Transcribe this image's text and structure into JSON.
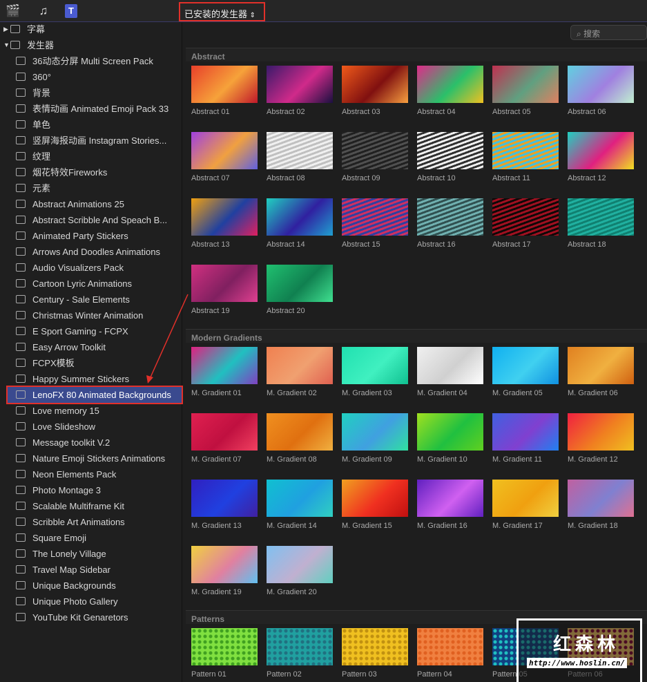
{
  "toolbar": {
    "picker_label": "已安装的发生器",
    "picker_chevron": "⌃⌄",
    "icons": [
      "clapper-icon",
      "music-icon",
      "titles-generators-icon"
    ]
  },
  "sidebar": {
    "titles": "字幕",
    "generators": "发生器",
    "items": [
      "36动态分屏 Multi Screen Pack",
      "360°",
      "背景",
      "表情动画 Animated Emoji Pack 33",
      "单色",
      "竖屏海报动画 Instagram Stories...",
      "纹理",
      "烟花特效Fireworks",
      "元素",
      "Abstract Animations 25",
      "Abstract Scribble And Speach B...",
      "Animated Party Stickers",
      "Arrows And Doodles Animations",
      "Audio Visualizers Pack",
      "Cartoon Lyric Animations",
      "Century - Sale Elements",
      "Christmas Winter Animation",
      "E Sport Gaming - FCPX",
      "Easy Arrow Toolkit",
      "FCPX模板",
      "Happy Summer Stickers",
      "LenoFX 80 Animated Backgrounds",
      "Love memory 15",
      "Love Slideshow",
      "Message toolkit V.2",
      "Nature Emoji Stickers Animations",
      "Neon Elements Pack",
      "Photo Montage 3",
      "Scalable Multiframe Kit",
      "Scribble Art Animations",
      "Square Emoji",
      "The Lonely Village",
      "Travel Map Sidebar",
      "Unique Backgrounds",
      "Unique Photo Gallery",
      "YouTube Kit Genaretors"
    ],
    "selected_index": 21
  },
  "search": {
    "placeholder": "搜索"
  },
  "sections": [
    {
      "title": "Abstract",
      "items": [
        {
          "label": "Abstract 01",
          "c": [
            "#e8402a",
            "#f6a23a",
            "#c0182a"
          ]
        },
        {
          "label": "Abstract 02",
          "c": [
            "#3a1a6a",
            "#d02a8a",
            "#1a1040"
          ]
        },
        {
          "label": "Abstract 03",
          "c": [
            "#f05a1a",
            "#801010",
            "#f8a040"
          ]
        },
        {
          "label": "Abstract 04",
          "c": [
            "#e02a8a",
            "#2ac06a",
            "#f0c020"
          ]
        },
        {
          "label": "Abstract 05",
          "c": [
            "#c03050",
            "#60a080",
            "#e08060"
          ]
        },
        {
          "label": "Abstract 06",
          "c": [
            "#60d0e0",
            "#a080e0",
            "#c0f0d0"
          ]
        },
        {
          "label": "Abstract 07",
          "c": [
            "#a040e0",
            "#f0a040",
            "#6060e0"
          ]
        },
        {
          "label": "Abstract 08",
          "c": [
            "#f0f0f0",
            "#c0c0c0",
            "#808080"
          ]
        },
        {
          "label": "Abstract 09",
          "c": [
            "#202020",
            "#505050",
            "#303030"
          ]
        },
        {
          "label": "Abstract 10",
          "c": [
            "#f0f0f0",
            "#303030",
            "#e0e0e0"
          ]
        },
        {
          "label": "Abstract 11",
          "c": [
            "#f0a020",
            "#40c0e0",
            "#e04080"
          ]
        },
        {
          "label": "Abstract 12",
          "c": [
            "#20d0c0",
            "#e02080",
            "#f0e020"
          ]
        },
        {
          "label": "Abstract 13",
          "c": [
            "#f0a010",
            "#2040a0",
            "#e02060"
          ]
        },
        {
          "label": "Abstract 14",
          "c": [
            "#20d0c0",
            "#3020a0",
            "#20a0d0"
          ]
        },
        {
          "label": "Abstract 15",
          "c": [
            "#d03060",
            "#3040a0",
            "#c02050"
          ]
        },
        {
          "label": "Abstract 16",
          "c": [
            "#70b0b0",
            "#305050",
            "#90d0d0"
          ]
        },
        {
          "label": "Abstract 17",
          "c": [
            "#100808",
            "#a01020",
            "#200808"
          ]
        },
        {
          "label": "Abstract 18",
          "c": [
            "#20b0a0",
            "#108070",
            "#40d0c0"
          ]
        },
        {
          "label": "Abstract 19",
          "c": [
            "#d03080",
            "#802060",
            "#e04090"
          ]
        },
        {
          "label": "Abstract 20",
          "c": [
            "#20c070",
            "#108050",
            "#40e090"
          ]
        }
      ]
    },
    {
      "title": "Modern Gradients",
      "items": [
        {
          "label": "M. Gradient 01",
          "c": [
            "#e02080",
            "#20c0c0",
            "#8040c0"
          ]
        },
        {
          "label": "M. Gradient 02",
          "c": [
            "#f08050",
            "#f0a070",
            "#e06050"
          ]
        },
        {
          "label": "M. Gradient 03",
          "c": [
            "#20e0b0",
            "#40f0c0",
            "#10c090"
          ]
        },
        {
          "label": "M. Gradient 04",
          "c": [
            "#f0f0f0",
            "#d0d0d0",
            "#ffffff"
          ]
        },
        {
          "label": "M. Gradient 05",
          "c": [
            "#10b0f0",
            "#40d0f0",
            "#1090e0"
          ]
        },
        {
          "label": "M. Gradient 06",
          "c": [
            "#e08020",
            "#f0b040",
            "#d06010"
          ]
        },
        {
          "label": "M. Gradient 07",
          "c": [
            "#e02050",
            "#c01040",
            "#f04060"
          ]
        },
        {
          "label": "M. Gradient 08",
          "c": [
            "#f09020",
            "#e07010",
            "#f0b040"
          ]
        },
        {
          "label": "M. Gradient 09",
          "c": [
            "#20d0c0",
            "#40a0e0",
            "#30e0a0"
          ]
        },
        {
          "label": "M. Gradient 10",
          "c": [
            "#a0e020",
            "#20c040",
            "#60d020"
          ]
        },
        {
          "label": "M. Gradient 11",
          "c": [
            "#4060e0",
            "#8040d0",
            "#2080f0"
          ]
        },
        {
          "label": "M. Gradient 12",
          "c": [
            "#f02040",
            "#f08020",
            "#f0c020"
          ]
        },
        {
          "label": "M. Gradient 13",
          "c": [
            "#3020c0",
            "#2040e0",
            "#4020a0"
          ]
        },
        {
          "label": "M. Gradient 14",
          "c": [
            "#10c0d0",
            "#20a0e0",
            "#30d0c0"
          ]
        },
        {
          "label": "M. Gradient 15",
          "c": [
            "#f0a020",
            "#f03020",
            "#c01010"
          ]
        },
        {
          "label": "M. Gradient 16",
          "c": [
            "#6020c0",
            "#d060f0",
            "#6020c0"
          ]
        },
        {
          "label": "M. Gradient 17",
          "c": [
            "#f0c020",
            "#f0a010",
            "#f0d040"
          ]
        },
        {
          "label": "M. Gradient 18",
          "c": [
            "#c060a0",
            "#8080d0",
            "#e07090"
          ]
        },
        {
          "label": "M. Gradient 19",
          "c": [
            "#f0d040",
            "#e080a0",
            "#60c0f0"
          ]
        },
        {
          "label": "M. Gradient 20",
          "c": [
            "#80c0f0",
            "#c0b0d0",
            "#60d0c0"
          ]
        }
      ]
    },
    {
      "title": "Patterns",
      "items": [
        {
          "label": "Pattern 01",
          "c": [
            "#80e040",
            "#40a020",
            "#a0f060"
          ]
        },
        {
          "label": "Pattern 02",
          "c": [
            "#20a0a0",
            "#207080",
            "#30c0b0"
          ]
        },
        {
          "label": "Pattern 03",
          "c": [
            "#f0c020",
            "#c09010",
            "#f0d040"
          ]
        },
        {
          "label": "Pattern 04",
          "c": [
            "#f08040",
            "#e06020",
            "#f0a060"
          ]
        },
        {
          "label": "Pattern 05",
          "c": [
            "#104080",
            "#20c0c0",
            "#104080"
          ]
        },
        {
          "label": "Pattern 06",
          "c": [
            "#f0c060",
            "#800030",
            "#f0c060"
          ]
        }
      ]
    }
  ],
  "watermark": {
    "cn": "红森林",
    "url": "http://www.hoslin.cn/"
  }
}
